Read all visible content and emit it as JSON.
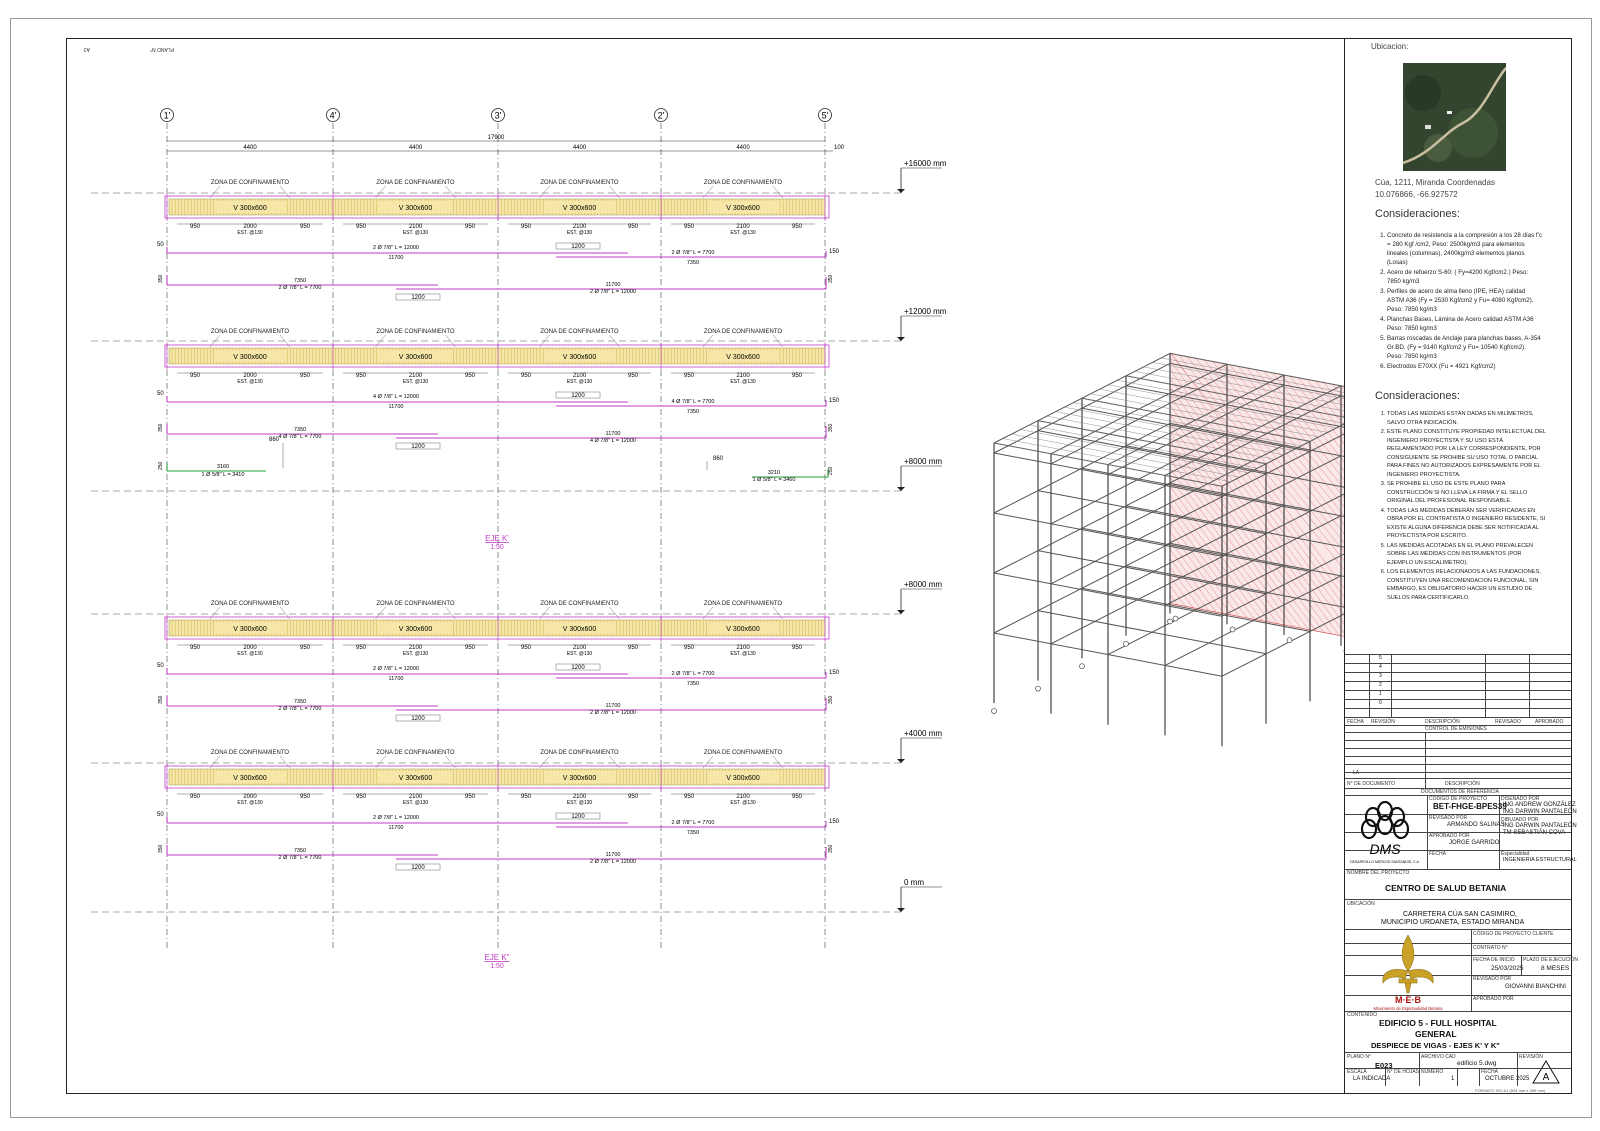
{
  "drawing": {
    "corner_left": "A3",
    "corner_right": "PLANO N°",
    "axes": [
      "1'",
      "4'",
      "3'",
      "2'",
      "5'"
    ],
    "total_span": "17900",
    "spans": [
      "4400",
      "4400",
      "4400",
      "4400"
    ],
    "end_offset": "100",
    "levels": [
      "+16000 mm",
      "+12000 mm",
      "+8000 mm",
      "+8000 mm",
      "+4000 mm",
      "0 mm"
    ],
    "zona": "ZONA DE CONFINAMIENTO",
    "beam": "V 300x600",
    "dims_first": [
      "950",
      "2000",
      "950"
    ],
    "dims_mid": [
      "950",
      "2100",
      "950"
    ],
    "est": "EST. @130",
    "lap_1200": "1200",
    "left_cover": "50",
    "right_cover": "150",
    "hook": "350",
    "bars_a": {
      "b1_label": "2 Ø 7/8\"  L = 12000",
      "b1_len": "11700",
      "b2_label": "2 Ø 7/8\"  L = 7700",
      "b2_len": "7350",
      "b3_len": "7350",
      "b3_label": "2 Ø 7/8\"  L = 7700",
      "b4_len": "11700",
      "b4_label": "2 Ø 7/8\"  L = 12000"
    },
    "bars_b": {
      "b1_label": "4 Ø 7/8\"  L = 12000",
      "b1_len": "11700",
      "b2_label": "4 Ø 7/8\"  L = 7700",
      "b2_len": "7350",
      "b3_len": "7350",
      "b3_label": "4 Ø 7/8\"  L = 7700",
      "b4_len": "11700",
      "b4_label": "4 Ø 7/8\"  L = 12000",
      "g1_len": "3160",
      "g1_label": "1 Ø 5/8\"  L = 3410",
      "g2_len": "3210",
      "g2_label": "1 Ø 5/8\"  L = 3460",
      "g_hook": "250",
      "g_off": "860"
    },
    "section_title_1": "EJE K'",
    "section_scale_1": "1:50",
    "section_title_2": "EJE K\"",
    "section_scale_2": "1:50"
  },
  "panel": {
    "ubicacion_label": "Ubicacion:",
    "ubicacion_text_1": "Cúa,  1211,  Miranda  Coordenadas",
    "ubicacion_text_2": "10.076866,  -66.927572",
    "consid_title_1": "Consideraciones:",
    "consid_1": [
      "Concreto de resistencia a la compresión a los 28 días f'c = 280 Kgf /cm2, Peso: 2500kg/m3 para elementos lineales (columnas), 2400kg/m3 elementos planos (Losas)",
      "Acero de refuerzo S-60: ( Fy=4200 Kgf/cm2.)  Peso: 7850 kg/m3",
      "Perfiles de acero de alma lleno (IPE, HEA) calidad ASTM A36 (Fy = 2530 Kgf/cm2 y Fu= 4080 Kgf/cm2). Peso: 7850 kg/m3",
      "Planchas Bases, Lámina de Acero calidad ASTM A36 Peso: 7850 kg/m3",
      "Barras roscadas de Anclaje para planchas bases, A-354 Gr.BD. (Fy = 9140 Kgf/cm2 y Fu= 10540 Kgf/cm2). Peso: 7850 kg/m3",
      "Electrodos E70XX (Fu = 4921 Kgf/cm2)"
    ],
    "consid_title_2": "Consideraciones:",
    "consid_2": [
      "TODAS LAS MEDIDAS ESTÁN DADAS EN MILÍMETROS, SALVO OTRA INDICACIÓN.",
      "ESTE PLANO CONSTITUYE PROPIEDAD INTELECTUAL DEL INGENIERO PROYECTISTA Y SU USO ESTÁ REGLAMENTADO POR LA LEY CORRESPONDIENTE, POR CONSIGUIENTE SE PROHIBE SU USO TOTAL O PARCIAL PARA FINES NO AUTORIZADOS EXPRESAMENTE POR EL INGENIERO PROYECTISTA.",
      "SE PROHIBE EL USO DE ESTE PLANO PARA CONSTRUCCIÓN SI NO LLEVA LA FIRMA Y EL SELLO ORIGINAL DEL PROFESIONAL RESPONSABLE.",
      "TODAS LAS MEDIDAS DEBERÁN SER VERIFICADAS EN OBRA POR EL CONTRATISTA O INGENIERO RESIDENTE, SI EXISTE ALGUNA DIFERENCIA DEBE SER NOTIFICADA AL PROYECTISTA POR ESCRITO.",
      "LAS MEDIDAS ACOTADAS EN EL PLANO PREVALECEN SOBRE LAS MEDIDAS CON INSTRUMENTOS (POR EJEMPLO UN ESCALIMETRO).",
      "LOS ELEMENTOS RELACIONADOS A LAS FUNDACIONES, CONSTITUYEN UNA RECOMENDACION FUNCIONAL, SIN EMBARGO, ES OBLIGATORIO HACER UN ESTUDIO DE SUELOS PARA CERTIFICARLO."
    ],
    "rev_numbers": [
      "5",
      "4",
      "3",
      "2",
      "1",
      "0"
    ],
    "rev_headers": [
      "FECHA",
      "REVISIÓN",
      "DESCRIPCIÓN",
      "REVISADO",
      "APROBADO"
    ],
    "control_emisiones": "CONTROL DE EMISIONES",
    "la": "LA",
    "doc_headers": [
      "N° DE DOCUMENTO",
      "DESCRIPCIÓN"
    ],
    "doc_ref": "DOCUMENTOS DE REFERENCIA",
    "codigo_label": "CÓDIGO DE PROYECTO",
    "codigo": "BET-FHGE-BPES39",
    "disenado_label": "DISEÑADO POR",
    "disenado_1": "ING ANDREW GONZÁLEZ",
    "disenado_2": "ING DARWIN PANTALEÓN",
    "revisado_label": "REVISADO POR",
    "revisado": "ARMANDO SALINAS",
    "dibujado_label": "DIBUJADO POR",
    "dibujado_1": "ING DARWIN PANTALEÓN",
    "dibujado_2": "TM SEBASTIÁN COVA",
    "aprobado_label": "APROBADO POR",
    "aprobado": "JORGE GARRIDO",
    "fecha_label": "FECHA",
    "especialidad_label": "Especialidad",
    "especialidad": "INGENIERIA ESTRUCTURAL",
    "dms_logo": "DMS",
    "dms_sub": "DESARROLLO MERCOS SANTANDIS, C.A.",
    "nombre_label": "NOMBRE DEL PROYECTO",
    "nombre": "CENTRO DE SALUD BETANIA",
    "ubic_label": "UBICACIÓN",
    "ubic_1": "CARRETERA CÚA SAN CASIMIRO,",
    "ubic_2": "MUNICIPIO URDANETA, ESTADO MIRANDA",
    "cod_cliente": "CÓDIGO DE PROYECTO CLIENTE",
    "contrato": "CONTRATO N°",
    "fecha_inicio_label": "FECHA DE INICIO",
    "fecha_inicio": "25/03/2025",
    "plazo_label": "PLAZO DE EJECUCIÓN",
    "plazo": "8 MESES",
    "revisado2_label": "REVISADO POR",
    "revisado2": "GIOVANNI BIANCHINI",
    "aprobado2_label": "APROBADO POR",
    "meb_logo": "M·E·B",
    "meb_sub": "Movimiento de Espiritualidad Betania",
    "contenido_label": "CONTENIDO",
    "contenido_1": "EDIFICIO 5 - FULL HOSPITAL",
    "contenido_2": "GENERAL",
    "contenido_3": "DESPIECE DE VIGAS - EJES K' Y K\"",
    "plano_label": "PLANO N°",
    "plano": "E023",
    "archivo_label": "ARCHIVO CAD",
    "archivo": "edificio 5.dwg",
    "revision_label": "REVISIÓN",
    "revision": "A",
    "escala_label": "ESCALA",
    "escala": "LA INDICADA",
    "hojas_label": "N° DE HOJAS",
    "numero_label": "NÚMERO",
    "numero": "1",
    "fecha2_label": "FECHA",
    "fecha2": "OCTUBRE 2025",
    "formato": "FORMATO ISO A1 (594 mm x 389 mm)"
  },
  "colors": {
    "beam_fill": "#f6e7a8",
    "stirrup": "#c9b24a",
    "bar": "#c23ec6",
    "green": "#22a03a",
    "hatch": "#d43a3a"
  }
}
